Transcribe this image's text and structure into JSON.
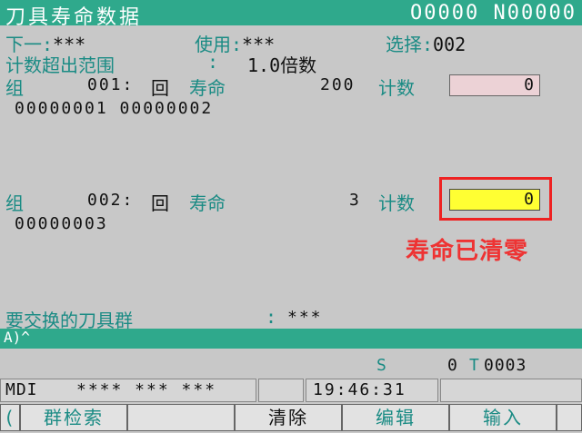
{
  "header": {
    "title": "刀具寿命数据",
    "program_number": "O0000 N00000"
  },
  "summary": {
    "next_label": "下一",
    "next_value": "***",
    "use_label": "使用",
    "use_value": "***",
    "select_label": "选择",
    "select_value": "002",
    "overflow_label": "计数超出范围",
    "overflow_value": "1.0倍数"
  },
  "groups": [
    {
      "label": "组",
      "number": "001",
      "unit": "回",
      "life_label": "寿命",
      "life_value": "200",
      "count_label": "计数",
      "count_value": "0",
      "tools": "00000001  00000002"
    },
    {
      "label": "组",
      "number": "002",
      "unit": "回",
      "life_label": "寿命",
      "life_value": "3",
      "count_label": "计数",
      "count_value": "0",
      "tools": "00000003"
    }
  ],
  "annotation": "寿命已清零",
  "exchange": {
    "label": "要交换的刀具群",
    "value": "***"
  },
  "input_prompt": "A)^",
  "status": {
    "s_label": "S",
    "s_value": "0",
    "t_label": "T",
    "t_value": "0003",
    "mode": "MDI",
    "stars": "**** *** ***",
    "time": "19:46:31"
  },
  "softkeys": {
    "left_arrow": "(",
    "group_search": "群检索",
    "clear": "清除",
    "edit": "编辑",
    "input": "输入"
  },
  "colors": {
    "header_bg": "#2fa98c",
    "highlight": "#ffff33",
    "annotation_red": "#e33333"
  }
}
